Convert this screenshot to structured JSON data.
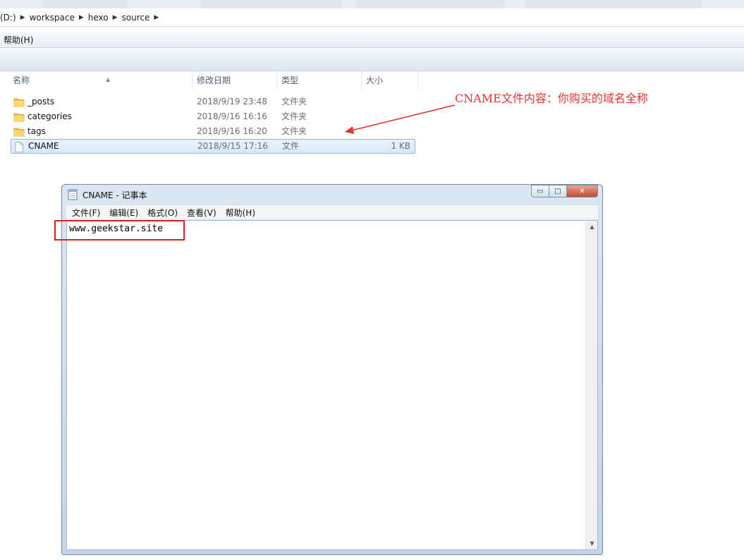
{
  "explorer": {
    "breadcrumb": [
      "(D:)",
      "workspace",
      "hexo",
      "source"
    ],
    "menu": {
      "help": "帮助(H)"
    },
    "columns": {
      "name": "名称",
      "modified": "修改日期",
      "type": "类型",
      "size": "大小"
    },
    "files": [
      {
        "name": "_posts",
        "modified": "2018/9/19 23:48",
        "type": "文件夹",
        "size": "",
        "kind": "folder-icon"
      },
      {
        "name": "categories",
        "modified": "2018/9/16 16:16",
        "type": "文件夹",
        "size": "",
        "kind": "folder-icon"
      },
      {
        "name": "tags",
        "modified": "2018/9/16 16:20",
        "type": "文件夹",
        "size": "",
        "kind": "folder-icon"
      },
      {
        "name": "CNAME",
        "modified": "2018/9/15 17:16",
        "type": "文件",
        "size": "1 KB",
        "kind": "file-icon",
        "selected": true
      }
    ]
  },
  "annotation": {
    "text": "CNAME文件内容：你购买的域名全称",
    "color": "#e8322f"
  },
  "notepad": {
    "title": "CNAME - 记事本",
    "menus": [
      "文件(F)",
      "编辑(E)",
      "格式(O)",
      "查看(V)",
      "帮助(H)"
    ],
    "content": "www.geekstar.site",
    "buttons": {
      "minimize": "▭",
      "maximize": "□",
      "close": "✕"
    }
  },
  "colors": {
    "selection": "#d7e8fb",
    "highlight_box": "#e02020",
    "folder": "#f0c24a"
  }
}
